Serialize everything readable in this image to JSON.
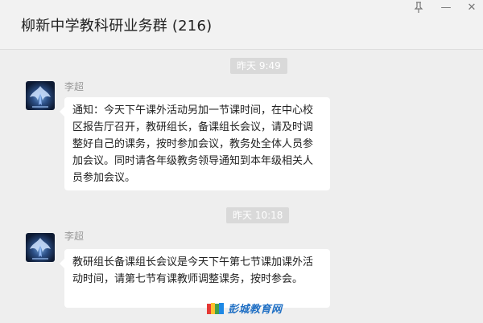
{
  "header": {
    "title": "柳新中学教科研业务群 (216)",
    "controls": {
      "pin": "⊥",
      "minimize": "—",
      "close": "✕"
    }
  },
  "messages": [
    {
      "time": "昨天 9:49",
      "sender": "李超",
      "text": "通知：今天下午课外活动另加一节课时间，在中心校区报告厅召开，教研组长，备课组长会议，请及时调整好自己的课务，按时参加会议，教务处全体人员参加会议。同时请各年级教务领导通知到本年级相关人员参加会议。"
    },
    {
      "time": "昨天 10:18",
      "sender": "李超",
      "text": "教研组长备课组长会议是今天下午第七节课加课外活动时间，请第七节有课教师调整课务，按时参会。"
    }
  ],
  "watermark": {
    "text": "彭城教育网"
  },
  "icons": {
    "avatar": "phoenix-avatar-icon",
    "pin": "pin-icon",
    "minimize": "minimize-icon",
    "close": "close-icon"
  }
}
